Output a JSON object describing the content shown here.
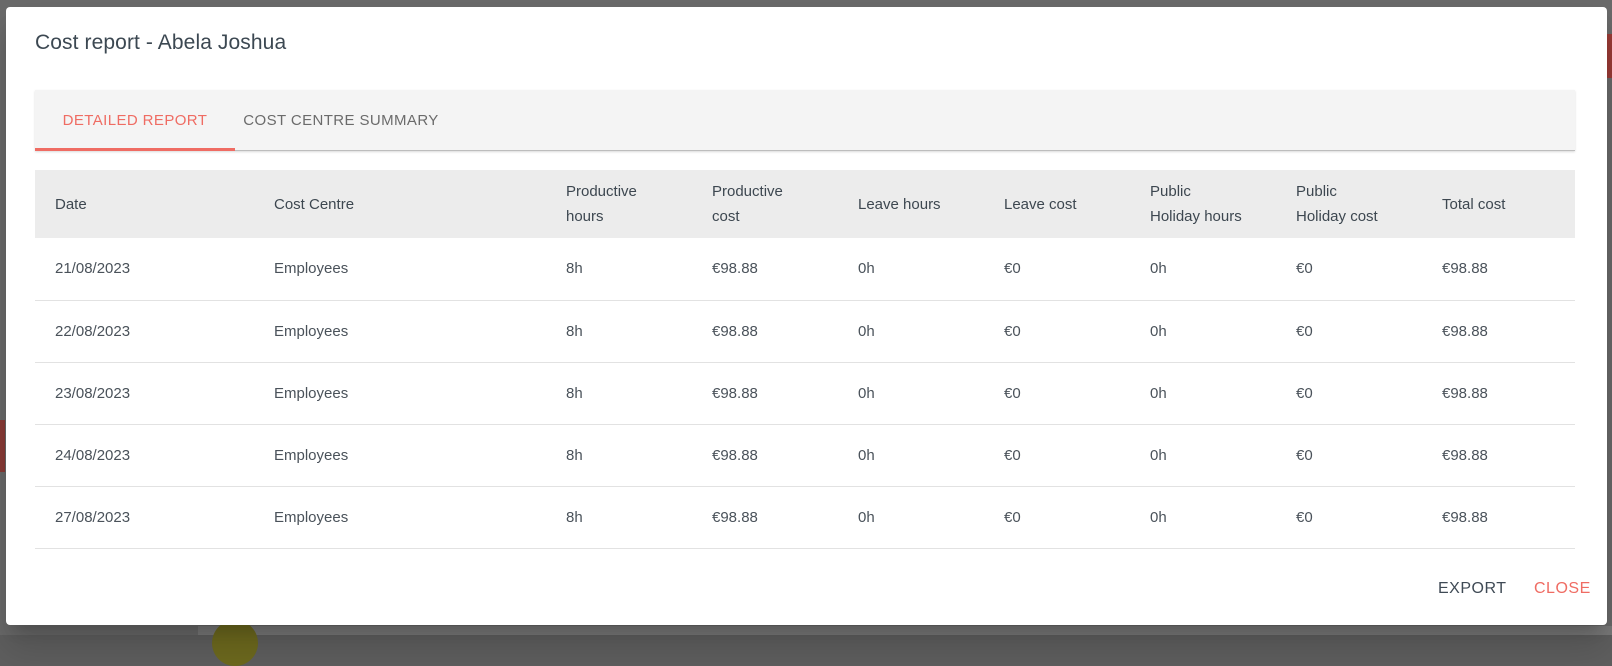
{
  "modal": {
    "title": "Cost report - Abela Joshua"
  },
  "tabs": [
    {
      "label": "DETAILED REPORT",
      "active": true
    },
    {
      "label": "COST CENTRE SUMMARY",
      "active": false
    }
  ],
  "table": {
    "headers": {
      "date": "Date",
      "cost_centre": "Cost Centre",
      "productive_hours_1": "Productive",
      "productive_hours_2": "hours",
      "productive_cost_1": "Productive",
      "productive_cost_2": "cost",
      "leave_hours": "Leave hours",
      "leave_cost": "Leave cost",
      "ph_hours_1": "Public",
      "ph_hours_2": "Holiday hours",
      "ph_cost_1": "Public",
      "ph_cost_2": "Holiday cost",
      "total_cost": "Total cost"
    },
    "rows": [
      {
        "date": "21/08/2023",
        "cost_centre": "Employees",
        "productive_hours": "8h",
        "productive_cost": "€98.88",
        "leave_hours": "0h",
        "leave_cost": "€0",
        "ph_hours": "0h",
        "ph_cost": "€0",
        "total_cost": "€98.88"
      },
      {
        "date": "22/08/2023",
        "cost_centre": "Employees",
        "productive_hours": "8h",
        "productive_cost": "€98.88",
        "leave_hours": "0h",
        "leave_cost": "€0",
        "ph_hours": "0h",
        "ph_cost": "€0",
        "total_cost": "€98.88"
      },
      {
        "date": "23/08/2023",
        "cost_centre": "Employees",
        "productive_hours": "8h",
        "productive_cost": "€98.88",
        "leave_hours": "0h",
        "leave_cost": "€0",
        "ph_hours": "0h",
        "ph_cost": "€0",
        "total_cost": "€98.88"
      },
      {
        "date": "24/08/2023",
        "cost_centre": "Employees",
        "productive_hours": "8h",
        "productive_cost": "€98.88",
        "leave_hours": "0h",
        "leave_cost": "€0",
        "ph_hours": "0h",
        "ph_cost": "€0",
        "total_cost": "€98.88"
      },
      {
        "date": "27/08/2023",
        "cost_centre": "Employees",
        "productive_hours": "8h",
        "productive_cost": "€98.88",
        "leave_hours": "0h",
        "leave_cost": "€0",
        "ph_hours": "0h",
        "ph_cost": "€0",
        "total_cost": "€98.88"
      }
    ]
  },
  "actions": {
    "export_label": "EXPORT",
    "close_label": "CLOSE"
  },
  "colors": {
    "accent": "#ef6c63",
    "text": "#3d4750",
    "header_bg": "#ececec",
    "tabbar_bg": "#f4f4f4"
  }
}
